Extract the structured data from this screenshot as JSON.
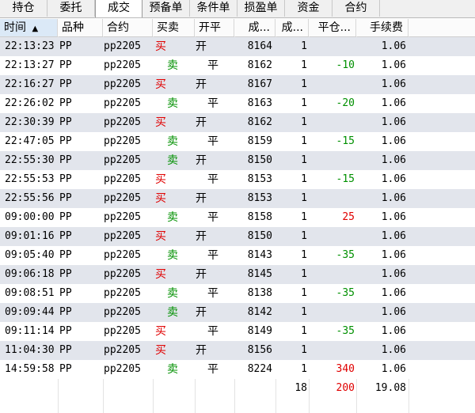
{
  "tabs": [
    {
      "label": "持仓",
      "active": false
    },
    {
      "label": "委托",
      "active": false
    },
    {
      "label": "成交",
      "active": true
    },
    {
      "label": "预备单",
      "active": false
    },
    {
      "label": "条件单",
      "active": false
    },
    {
      "label": "损盈单",
      "active": false
    },
    {
      "label": "资金",
      "active": false
    },
    {
      "label": "合约",
      "active": false
    }
  ],
  "table": {
    "sort_indicator": "▲",
    "columns": {
      "time": "时间",
      "product": "品种",
      "contract": "合约",
      "side": "买卖",
      "openclose": "开平",
      "price": "成...",
      "qty": "成...",
      "close_pnl": "平仓...",
      "fee": "手续费"
    },
    "rows": [
      {
        "time": "22:13:23",
        "product": "PP",
        "contract": "pp2205",
        "side": "买",
        "openclose": "开",
        "price": "8164",
        "qty": "1",
        "close_pnl": "",
        "fee": "1.06"
      },
      {
        "time": "22:13:27",
        "product": "PP",
        "contract": "pp2205",
        "side": "卖",
        "openclose": "平",
        "price": "8162",
        "qty": "1",
        "close_pnl": "-10",
        "fee": "1.06"
      },
      {
        "time": "22:16:27",
        "product": "PP",
        "contract": "pp2205",
        "side": "买",
        "openclose": "开",
        "price": "8167",
        "qty": "1",
        "close_pnl": "",
        "fee": "1.06"
      },
      {
        "time": "22:26:02",
        "product": "PP",
        "contract": "pp2205",
        "side": "卖",
        "openclose": "平",
        "price": "8163",
        "qty": "1",
        "close_pnl": "-20",
        "fee": "1.06"
      },
      {
        "time": "22:30:39",
        "product": "PP",
        "contract": "pp2205",
        "side": "买",
        "openclose": "开",
        "price": "8162",
        "qty": "1",
        "close_pnl": "",
        "fee": "1.06"
      },
      {
        "time": "22:47:05",
        "product": "PP",
        "contract": "pp2205",
        "side": "卖",
        "openclose": "平",
        "price": "8159",
        "qty": "1",
        "close_pnl": "-15",
        "fee": "1.06"
      },
      {
        "time": "22:55:30",
        "product": "PP",
        "contract": "pp2205",
        "side": "卖",
        "openclose": "开",
        "price": "8150",
        "qty": "1",
        "close_pnl": "",
        "fee": "1.06"
      },
      {
        "time": "22:55:53",
        "product": "PP",
        "contract": "pp2205",
        "side": "买",
        "openclose": "平",
        "price": "8153",
        "qty": "1",
        "close_pnl": "-15",
        "fee": "1.06"
      },
      {
        "time": "22:55:56",
        "product": "PP",
        "contract": "pp2205",
        "side": "买",
        "openclose": "开",
        "price": "8153",
        "qty": "1",
        "close_pnl": "",
        "fee": "1.06"
      },
      {
        "time": "09:00:00",
        "product": "PP",
        "contract": "pp2205",
        "side": "卖",
        "openclose": "平",
        "price": "8158",
        "qty": "1",
        "close_pnl": "25",
        "fee": "1.06"
      },
      {
        "time": "09:01:16",
        "product": "PP",
        "contract": "pp2205",
        "side": "买",
        "openclose": "开",
        "price": "8150",
        "qty": "1",
        "close_pnl": "",
        "fee": "1.06"
      },
      {
        "time": "09:05:40",
        "product": "PP",
        "contract": "pp2205",
        "side": "卖",
        "openclose": "平",
        "price": "8143",
        "qty": "1",
        "close_pnl": "-35",
        "fee": "1.06"
      },
      {
        "time": "09:06:18",
        "product": "PP",
        "contract": "pp2205",
        "side": "买",
        "openclose": "开",
        "price": "8145",
        "qty": "1",
        "close_pnl": "",
        "fee": "1.06"
      },
      {
        "time": "09:08:51",
        "product": "PP",
        "contract": "pp2205",
        "side": "卖",
        "openclose": "平",
        "price": "8138",
        "qty": "1",
        "close_pnl": "-35",
        "fee": "1.06"
      },
      {
        "time": "09:09:44",
        "product": "PP",
        "contract": "pp2205",
        "side": "卖",
        "openclose": "开",
        "price": "8142",
        "qty": "1",
        "close_pnl": "",
        "fee": "1.06"
      },
      {
        "time": "09:11:14",
        "product": "PP",
        "contract": "pp2205",
        "side": "买",
        "openclose": "平",
        "price": "8149",
        "qty": "1",
        "close_pnl": "-35",
        "fee": "1.06"
      },
      {
        "time": "11:04:30",
        "product": "PP",
        "contract": "pp2205",
        "side": "买",
        "openclose": "开",
        "price": "8156",
        "qty": "1",
        "close_pnl": "",
        "fee": "1.06"
      },
      {
        "time": "14:59:58",
        "product": "PP",
        "contract": "pp2205",
        "side": "卖",
        "openclose": "平",
        "price": "8224",
        "qty": "1",
        "close_pnl": "340",
        "fee": "1.06"
      }
    ],
    "totals": {
      "qty": "18",
      "close_pnl": "200",
      "fee": "19.08"
    }
  },
  "colors": {
    "buy": "#e00000",
    "sell": "#009000",
    "stripe": "#e2e5ec",
    "sorted_header": "#dbe9f7"
  }
}
